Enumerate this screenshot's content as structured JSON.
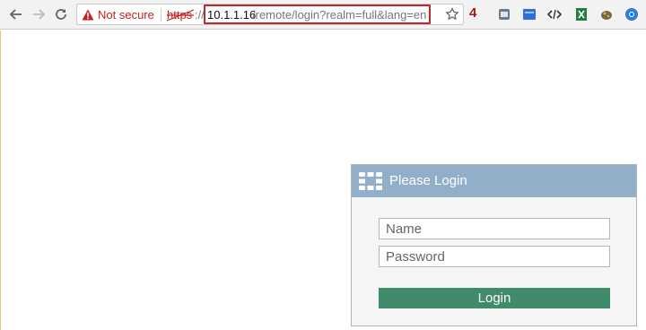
{
  "browser": {
    "security_label": "Not secure",
    "url_scheme": "https",
    "url_slashes": "://",
    "url_host": "10.1.1.16",
    "url_path": "/remote/login?realm=full&lang=en",
    "annotation_number": "4",
    "icons": {
      "back": "arrow-left-icon",
      "forward": "arrow-right-icon",
      "reload": "reload-icon",
      "warning": "warning-triangle-icon",
      "bookmark": "star-icon"
    },
    "extensions": [
      "extension-window-icon",
      "extension-blue-icon",
      "extension-code-icon",
      "extension-green-icon",
      "extension-puzzle-icon",
      "extension-chrome-icon"
    ]
  },
  "login": {
    "title": "Please Login",
    "name_placeholder": "Name",
    "password_placeholder": "Password",
    "submit_label": "Login",
    "logo_icon": "fortinet-grid-icon"
  },
  "colors": {
    "header_bg": "#91afc9",
    "button_bg": "#3f8b6b",
    "insecure_red": "#c5221f",
    "highlight_red": "#c0272d"
  }
}
